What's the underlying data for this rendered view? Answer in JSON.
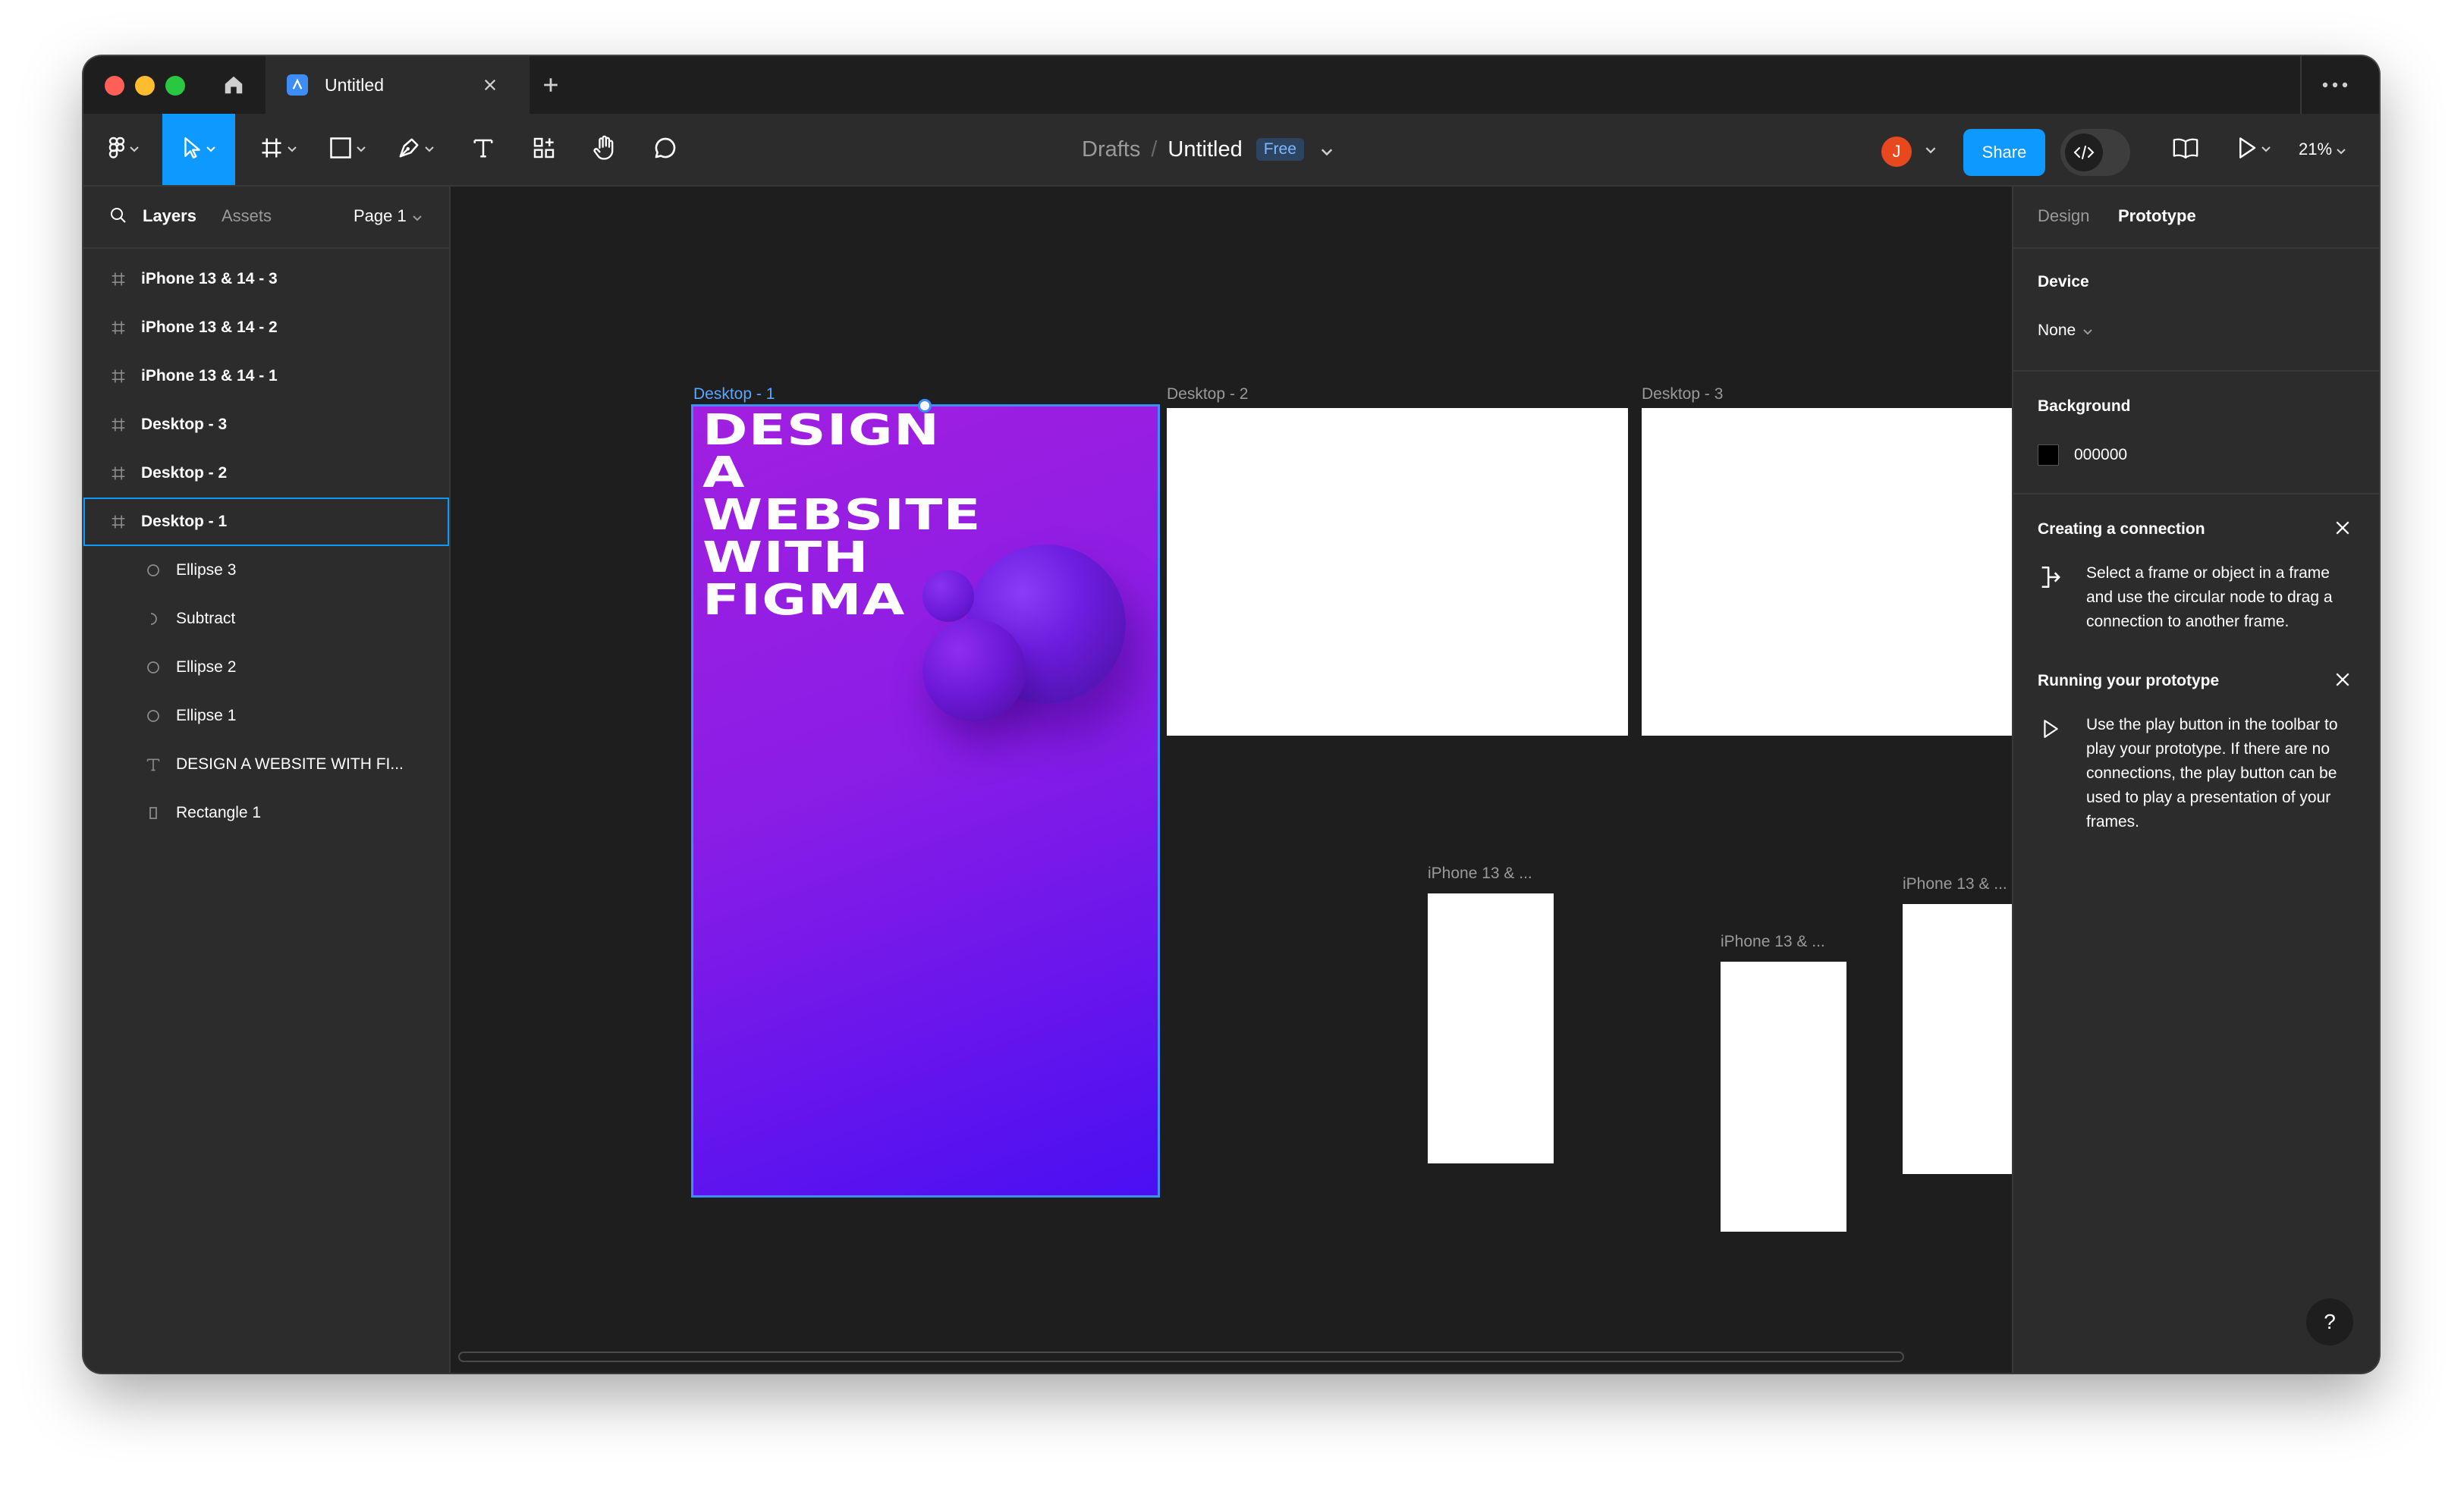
{
  "titlebar": {
    "tab_title": "Untitled",
    "icons": [
      "home-icon",
      "figma-file-icon",
      "close-icon",
      "plus-icon",
      "more-icon"
    ]
  },
  "toolbar": {
    "tools": [
      "main-menu",
      "move",
      "frame",
      "shape",
      "pen",
      "text",
      "resources",
      "hand",
      "comment"
    ],
    "breadcrumb": {
      "parent": "Drafts",
      "separator": "/",
      "title": "Untitled",
      "badge": "Free"
    },
    "avatar_initial": "J",
    "share_label": "Share",
    "zoom": "21%"
  },
  "left_panel": {
    "tabs": {
      "layers": "Layers",
      "assets": "Assets"
    },
    "page": "Page 1",
    "layers": [
      {
        "label": "iPhone 13 & 14 - 3",
        "type": "frame",
        "level": 0
      },
      {
        "label": "iPhone 13 & 14 - 2",
        "type": "frame",
        "level": 0
      },
      {
        "label": "iPhone 13 & 14 - 1",
        "type": "frame",
        "level": 0
      },
      {
        "label": "Desktop - 3",
        "type": "frame",
        "level": 0
      },
      {
        "label": "Desktop - 2",
        "type": "frame",
        "level": 0
      },
      {
        "label": "Desktop - 1",
        "type": "frame",
        "level": 0,
        "selected": true
      },
      {
        "label": "Ellipse 3",
        "type": "ellipse",
        "level": 1
      },
      {
        "label": "Subtract",
        "type": "subtract",
        "level": 1
      },
      {
        "label": "Ellipse 2",
        "type": "ellipse",
        "level": 1
      },
      {
        "label": "Ellipse 1",
        "type": "ellipse",
        "level": 1
      },
      {
        "label": "DESIGN A WEBSITE WITH FI...",
        "type": "text",
        "level": 1
      },
      {
        "label": "Rectangle 1",
        "type": "rectangle",
        "level": 1
      }
    ]
  },
  "canvas": {
    "frames": {
      "desktop1": "Desktop - 1",
      "desktop2": "Desktop - 2",
      "desktop3": "Desktop - 3",
      "iphone_a": "iPhone 13 & ...",
      "iphone_b": "iPhone 13 & ...",
      "iphone_c": "iPhone 13 & ..."
    },
    "hero_title_lines": [
      "DESIGN",
      "A",
      "WEBSITE",
      "WITH",
      "FIGMA"
    ],
    "hero_colors": {
      "start": "#a11fe0",
      "end": "#4a0ff2"
    },
    "selection_color": "#0d99ff"
  },
  "right_panel": {
    "tabs": {
      "design": "Design",
      "prototype": "Prototype"
    },
    "device": {
      "heading": "Device",
      "value": "None"
    },
    "background": {
      "heading": "Background",
      "value": "000000",
      "color": "#000000"
    },
    "tips": [
      {
        "heading": "Creating a connection",
        "text": "Select a frame or object in a frame and use the circular node to drag a connection to another frame.",
        "icon": "connection-icon"
      },
      {
        "heading": "Running your prototype",
        "text": "Use the play button in the toolbar to play your prototype. If there are no connections, the play button can be used to play a presentation of your frames.",
        "icon": "play-icon"
      }
    ],
    "help": "?"
  }
}
